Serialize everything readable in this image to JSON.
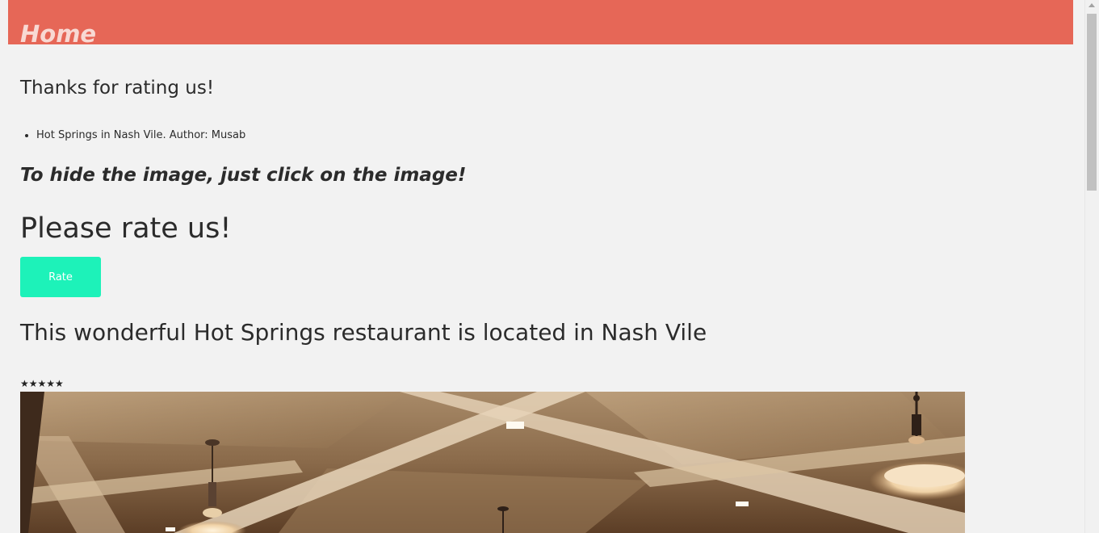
{
  "header": {
    "title": "Home",
    "background_color": "#e66757"
  },
  "main": {
    "thanks_heading": "Thanks for rating us!",
    "reviews": [
      "Hot Springs in Nash Vile. Author: Musab"
    ],
    "hide_hint": "To hide the image, just click on the image!",
    "rate_prompt": "Please rate us!",
    "rate_button_label": "Rate",
    "rate_button_color": "#1df2b9",
    "restaurant_heading": "This wonderful Hot Springs restaurant is located in Nash Vile",
    "stars_text": "★★★★★",
    "rating_stars": 5,
    "photo_icon": "restaurant-interior-photo"
  }
}
